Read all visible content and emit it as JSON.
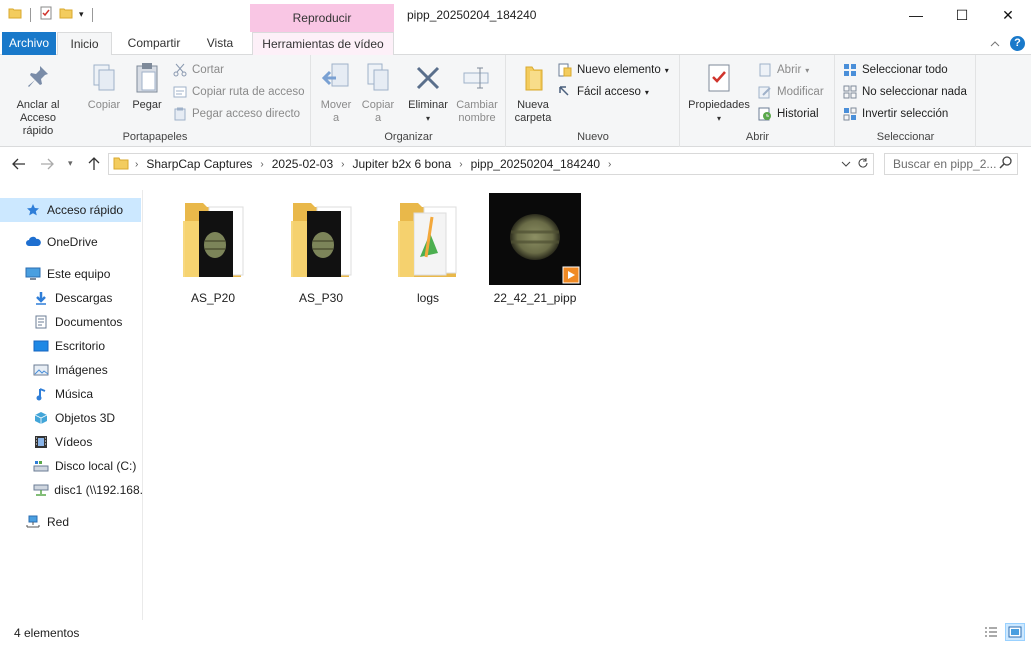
{
  "window": {
    "title": "pipp_20250204_184240",
    "context_tab": "Reproducir",
    "minimize": "—",
    "maximize": "☐",
    "close": "✕"
  },
  "ribbon_tabs": {
    "file": "Archivo",
    "home": "Inicio",
    "share": "Compartir",
    "view": "Vista",
    "video_tools": "Herramientas de vídeo",
    "collapse": "^",
    "help": "?"
  },
  "groups": {
    "clipboard": {
      "label": "Portapapeles",
      "pin": "Anclar al\nAcceso rápido",
      "pin_line1": "Anclar al",
      "pin_line2": "Acceso rápido",
      "copy": "Copiar",
      "paste": "Pegar",
      "cut": "Cortar",
      "copy_path": "Copiar ruta de acceso",
      "paste_shortcut": "Pegar acceso directo"
    },
    "organize": {
      "label": "Organizar",
      "move_to_line1": "Mover",
      "move_to_line2": "a",
      "copy_to_line1": "Copiar",
      "copy_to_line2": "a",
      "delete": "Eliminar",
      "rename_line1": "Cambiar",
      "rename_line2": "nombre"
    },
    "new": {
      "label": "Nuevo",
      "new_folder_line1": "Nueva",
      "new_folder_line2": "carpeta",
      "new_item": "Nuevo elemento",
      "easy_access": "Fácil acceso"
    },
    "open": {
      "label": "Abrir",
      "properties": "Propiedades",
      "open": "Abrir",
      "edit": "Modificar",
      "history": "Historial"
    },
    "select": {
      "label": "Seleccionar",
      "select_all": "Seleccionar todo",
      "select_none": "No seleccionar nada",
      "invert": "Invertir selección"
    }
  },
  "address": {
    "crumbs": [
      "SharpCap Captures",
      "2025-02-03",
      "Jupiter b2x 6 bona",
      "pipp_20250204_184240"
    ],
    "search_placeholder": "Buscar en pipp_2..."
  },
  "nav": {
    "quick_access": "Acceso rápido",
    "onedrive": "OneDrive",
    "this_pc": "Este equipo",
    "downloads": "Descargas",
    "documents": "Documentos",
    "desktop": "Escritorio",
    "pictures": "Imágenes",
    "music": "Música",
    "objects3d": "Objetos 3D",
    "videos": "Vídeos",
    "local_disk": "Disco local (C:)",
    "network_drive": "disc1 (\\\\192.168.",
    "network": "Red"
  },
  "files": [
    {
      "name": "AS_P20",
      "type": "folder"
    },
    {
      "name": "AS_P30",
      "type": "folder"
    },
    {
      "name": "logs",
      "type": "folder"
    },
    {
      "name": "22_42_21_pipp",
      "type": "video"
    }
  ],
  "status": {
    "count": "4 elementos"
  },
  "colors": {
    "accent": "#1979ca",
    "context_tab": "#f9c6e4",
    "selection": "#cce8ff",
    "folder": "#f3cc5e"
  }
}
